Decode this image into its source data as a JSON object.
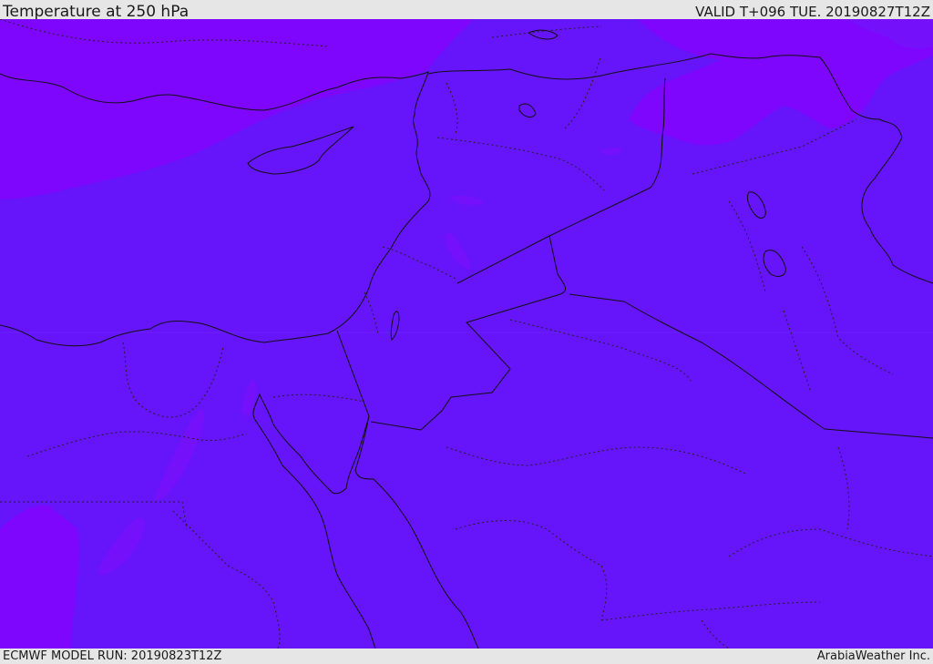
{
  "header": {
    "title": "Temperature at 250 hPa",
    "valid": "VALID T+096 TUE. 20190827T12Z"
  },
  "footer": {
    "model_run": "ECMWF MODEL RUN: 20190823T12Z",
    "credit": "ArabiaWeather Inc."
  },
  "map": {
    "field": "Temperature",
    "level": "250 hPa",
    "colors": {
      "base": "#6614fa",
      "warm_shade": "#7e06fc",
      "mid_shade": "#7510fb",
      "coast_border": "#111111",
      "admin_border": "#222222"
    }
  }
}
